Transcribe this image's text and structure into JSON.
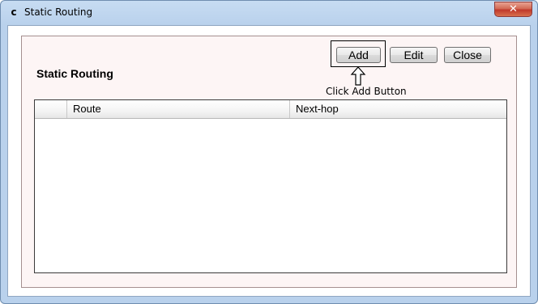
{
  "window": {
    "icon_glyph": "c",
    "title": "Static Routing",
    "close_glyph": "✕"
  },
  "panel": {
    "heading": "Static Routing",
    "buttons": {
      "add": "Add",
      "edit": "Edit",
      "close": "Close"
    },
    "callout": "Click Add Button"
  },
  "grid": {
    "columns": [
      "",
      "Route",
      "Next-hop"
    ],
    "rows": []
  },
  "icons": {
    "app": "app-icon",
    "close": "close-icon",
    "pointer": "up-arrow-icon"
  }
}
